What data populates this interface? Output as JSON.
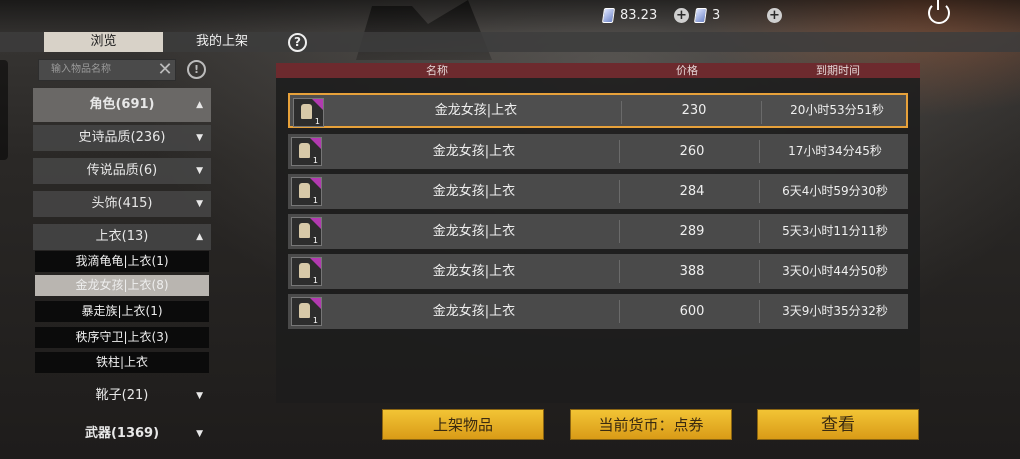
{
  "topbar": {
    "currency1_value": "83.23",
    "currency2_value": "3"
  },
  "tabs": {
    "browse": "浏览",
    "my_listings": "我的上架",
    "help": "?"
  },
  "search": {
    "placeholder": "输入物品名称"
  },
  "sidebar": {
    "categories": [
      {
        "label": "角色(691)"
      },
      {
        "label": "史诗品质(236)"
      },
      {
        "label": "传说品质(6)"
      },
      {
        "label": "头饰(415)"
      },
      {
        "label": "上衣(13)"
      }
    ],
    "subitems": [
      {
        "label": "我滴龟龟|上衣(1)"
      },
      {
        "label": "金龙女孩|上衣(8)"
      },
      {
        "label": "暴走族|上衣(1)"
      },
      {
        "label": "秩序守卫|上衣(3)"
      },
      {
        "label": "铁柱|上衣"
      }
    ],
    "more": [
      {
        "label": "靴子(21)"
      },
      {
        "label": "武器(1369)"
      }
    ]
  },
  "table": {
    "headers": {
      "name": "名称",
      "price": "价格",
      "expire": "到期时间"
    },
    "rows": [
      {
        "qty": "1",
        "name": "金龙女孩|上衣",
        "price": "230",
        "expire": "20小时53分51秒"
      },
      {
        "qty": "1",
        "name": "金龙女孩|上衣",
        "price": "260",
        "expire": "17小时34分45秒"
      },
      {
        "qty": "1",
        "name": "金龙女孩|上衣",
        "price": "284",
        "expire": "6天4小时59分30秒"
      },
      {
        "qty": "1",
        "name": "金龙女孩|上衣",
        "price": "289",
        "expire": "5天3小时11分11秒"
      },
      {
        "qty": "1",
        "name": "金龙女孩|上衣",
        "price": "388",
        "expire": "3天0小时44分50秒"
      },
      {
        "qty": "1",
        "name": "金龙女孩|上衣",
        "price": "600",
        "expire": "3天9小时35分32秒"
      }
    ]
  },
  "buttons": {
    "list_item": "上架物品",
    "currency": "当前货币：点券",
    "view": "查看"
  },
  "colors": {
    "accent_gold": "#f2c435",
    "header_red": "#6d2a2e",
    "selected_border": "#e7a13a"
  }
}
